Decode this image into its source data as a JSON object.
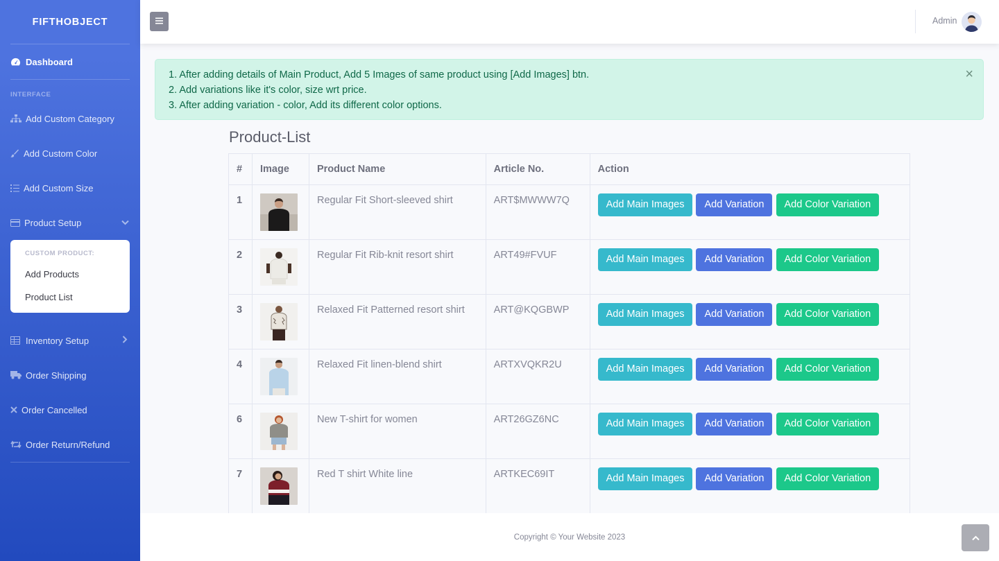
{
  "brand": "FIFTHOBJECT",
  "sidebar": {
    "dashboard": "Dashboard",
    "heading_interface": "INTERFACE",
    "items": {
      "custom_category": "Add Custom Category",
      "custom_color": "Add Custom Color",
      "custom_size": "Add Custom Size",
      "product_setup": "Product Setup",
      "inventory_setup": "Inventory Setup",
      "order_shipping": "Order Shipping",
      "order_cancelled": "Order Cancelled",
      "order_return": "Order Return/Refund"
    },
    "submenu": {
      "heading": "CUSTOM PRODUCT:",
      "add_products": "Add Products",
      "product_list": "Product List"
    }
  },
  "topbar": {
    "user_name": "Admin"
  },
  "alert": {
    "lines": [
      "1. After adding details of Main Product, Add 5 Images of same product using [Add Images] btn.",
      "2. Add variations like it's color, size wrt price.",
      "3. After adding variation - color, Add its different color options."
    ],
    "close": "×"
  },
  "page_title": "Product-List",
  "table": {
    "headers": [
      "#",
      "Image",
      "Product Name",
      "Article No.",
      "Action"
    ],
    "buttons": {
      "main_images": "Add Main Images",
      "variation": "Add Variation",
      "color_variation": "Add Color Variation"
    },
    "rows": [
      {
        "num": "1",
        "name": "Regular Fit Short-sleeved shirt",
        "article": "ART$MWWW7Q"
      },
      {
        "num": "2",
        "name": "Regular Fit Rib-knit resort shirt",
        "article": "ART49#FVUF"
      },
      {
        "num": "3",
        "name": "Relaxed Fit Patterned resort shirt",
        "article": "ART@KQGBWP"
      },
      {
        "num": "4",
        "name": "Relaxed Fit linen-blend shirt",
        "article": "ARTXVQKR2U"
      },
      {
        "num": "6",
        "name": "New T-shirt for women",
        "article": "ART26GZ6NC"
      },
      {
        "num": "7",
        "name": "Red T shirt White line",
        "article": "ARTKEC69IT"
      }
    ]
  },
  "footer": {
    "copyright": "Copyright © Your Website 2023"
  },
  "colors": {
    "sidebar_top": "#4e73df",
    "sidebar_bottom": "#224abe",
    "info": "#36b9cc",
    "primary": "#4e73df",
    "success": "#1cc88a",
    "alert_bg": "#d2f4e8"
  }
}
